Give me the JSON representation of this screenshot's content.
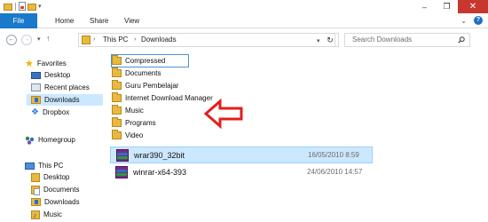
{
  "ribbon": {
    "file_label": "File",
    "tabs": [
      "Home",
      "Share",
      "View"
    ]
  },
  "window": {
    "minimize": "–",
    "maximize": "❐",
    "close": "✕"
  },
  "address": {
    "crumbs": [
      "This PC",
      "Downloads"
    ],
    "search_placeholder": "Search Downloads"
  },
  "nav": {
    "favorites_label": "Favorites",
    "favorites": [
      "Desktop",
      "Recent places",
      "Downloads",
      "Dropbox"
    ],
    "homegroup_label": "Homegroup",
    "thispc_label": "This PC",
    "thispc": [
      "Desktop",
      "Documents",
      "Downloads",
      "Music"
    ]
  },
  "content": {
    "folders": [
      "Compressed",
      "Documents",
      "Guru Pembelajar",
      "Internet Download Manager",
      "Music",
      "Programs",
      "Video"
    ],
    "files": [
      {
        "name": "wrar390_32bit",
        "date": "16/05/2010 8:59"
      },
      {
        "name": "winrar-x64-393",
        "date": "24/06/2010 14:57"
      }
    ]
  },
  "colors": {
    "accent": "#1979ca",
    "selection": "#cce8ff",
    "arrow": "#e0201b"
  }
}
